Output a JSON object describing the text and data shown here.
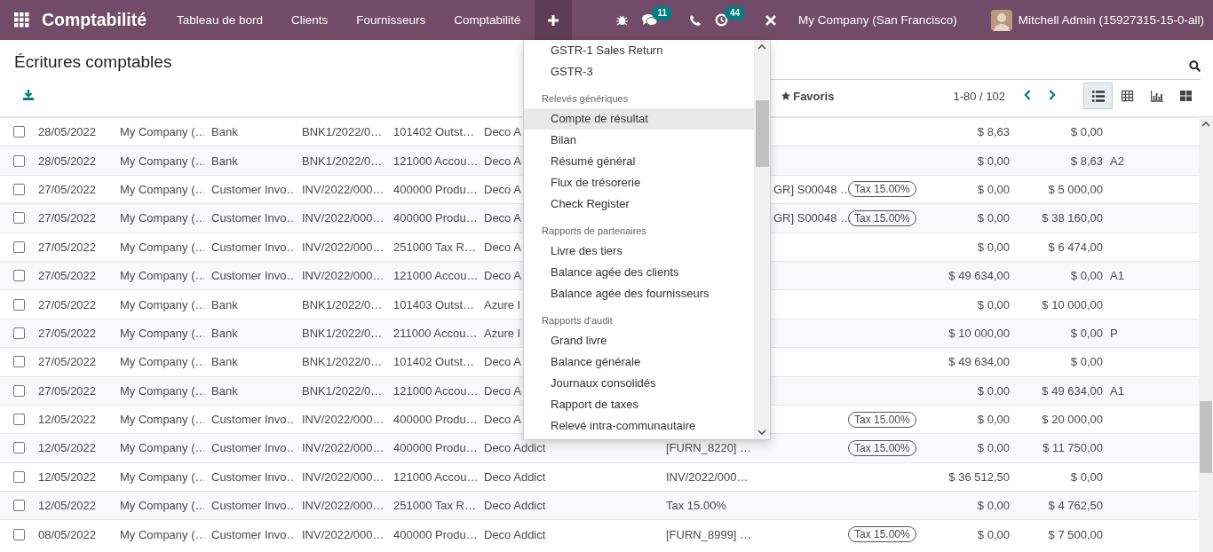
{
  "navbar": {
    "app_title": "Comptabilité",
    "menus": [
      "Tableau de bord",
      "Clients",
      "Fournisseurs",
      "Comptabilité"
    ],
    "quick_menu": {
      "expanded": true
    },
    "messages_badge": "11",
    "activities_badge": "44",
    "company": "My Company (San Francisco)",
    "user": "Mitchell Admin (15927315-15-0-all)"
  },
  "control_panel": {
    "title": "Écritures comptables",
    "favorites": "Favoris",
    "pager": "1-80 / 102",
    "views": [
      {
        "kind": "list",
        "selected": true
      },
      {
        "kind": "pivot",
        "selected": false
      },
      {
        "kind": "graph",
        "selected": false
      },
      {
        "kind": "kanban",
        "selected": false
      }
    ]
  },
  "report_menu": {
    "items": [
      {
        "kind": "item",
        "label": "GSTR-1 Sales Return",
        "selected": false
      },
      {
        "kind": "item",
        "label": "GSTR-3",
        "selected": false
      },
      {
        "kind": "header",
        "label": "Relevés génériques"
      },
      {
        "kind": "item",
        "label": "Compte de résultat",
        "selected": true
      },
      {
        "kind": "item",
        "label": "Bilan",
        "selected": false
      },
      {
        "kind": "item",
        "label": "Résumé général",
        "selected": false
      },
      {
        "kind": "item",
        "label": "Flux de trésorerie",
        "selected": false
      },
      {
        "kind": "item",
        "label": "Check Register",
        "selected": false
      },
      {
        "kind": "header",
        "label": "Rapports de partenaires"
      },
      {
        "kind": "item",
        "label": "Livre des tiers",
        "selected": false
      },
      {
        "kind": "item",
        "label": "Balance agée des clients",
        "selected": false
      },
      {
        "kind": "item",
        "label": "Balance agée des fournisseurs",
        "selected": false
      },
      {
        "kind": "header",
        "label": "Rapports d'audit"
      },
      {
        "kind": "item",
        "label": "Grand livre",
        "selected": false
      },
      {
        "kind": "item",
        "label": "Balance générale",
        "selected": false
      },
      {
        "kind": "item",
        "label": "Journaux consolidés",
        "selected": false
      },
      {
        "kind": "item",
        "label": "Rapport de taxes",
        "selected": false
      },
      {
        "kind": "item",
        "label": "Relevé intra-communautaire",
        "selected": false
      }
    ]
  },
  "table": {
    "rows": [
      {
        "checked": false,
        "date": "28/05/2022",
        "company": "My Company (…",
        "journal": "Bank",
        "entry": "BNK1/2022/0…",
        "account": "101402 Outst…",
        "partner": "Deco A",
        "label": "",
        "tax": "",
        "debit": "$ 8,63",
        "credit": "$ 0,00",
        "matching": ""
      },
      {
        "checked": false,
        "date": "28/05/2022",
        "company": "My Company (…",
        "journal": "Bank",
        "entry": "BNK1/2022/0…",
        "account": "121000 Accou…",
        "partner": "Deco A",
        "label": "",
        "tax": "",
        "debit": "$ 0,00",
        "credit": "$ 8,63",
        "matching": "A2"
      },
      {
        "checked": false,
        "date": "27/05/2022",
        "company": "My Company (…",
        "journal": "Customer Invo…",
        "entry": "INV/2022/000…",
        "account": "400000 Produ…",
        "partner": "Deco A",
        "label": "GR] S00048 …",
        "tax": "Tax 15.00%",
        "debit": "$ 0,00",
        "credit": "$ 5 000,00",
        "matching": ""
      },
      {
        "checked": false,
        "date": "27/05/2022",
        "company": "My Company (…",
        "journal": "Customer Invo…",
        "entry": "INV/2022/000…",
        "account": "400000 Produ…",
        "partner": "Deco A",
        "label": "GR] S00048 …",
        "tax": "Tax 15.00%",
        "debit": "$ 0,00",
        "credit": "$ 38 160,00",
        "matching": ""
      },
      {
        "checked": false,
        "date": "27/05/2022",
        "company": "My Company (…",
        "journal": "Customer Invo…",
        "entry": "INV/2022/000…",
        "account": "251000 Tax R…",
        "partner": "Deco A",
        "label": "",
        "tax": "",
        "debit": "$ 0,00",
        "credit": "$ 6 474,00",
        "matching": ""
      },
      {
        "checked": false,
        "date": "27/05/2022",
        "company": "My Company (…",
        "journal": "Customer Invo…",
        "entry": "INV/2022/000…",
        "account": "121000 Accou…",
        "partner": "Deco A",
        "label": "",
        "tax": "",
        "debit": "$ 49 634,00",
        "credit": "$ 0,00",
        "matching": "A1"
      },
      {
        "checked": false,
        "date": "27/05/2022",
        "company": "My Company (…",
        "journal": "Bank",
        "entry": "BNK1/2022/0…",
        "account": "101403 Outst…",
        "partner": "Azure I",
        "label": "",
        "tax": "",
        "debit": "$ 0,00",
        "credit": "$ 10 000,00",
        "matching": ""
      },
      {
        "checked": false,
        "date": "27/05/2022",
        "company": "My Company (…",
        "journal": "Bank",
        "entry": "BNK1/2022/0…",
        "account": "211000 Accou…",
        "partner": "Azure I",
        "label": "",
        "tax": "",
        "debit": "$ 10 000,00",
        "credit": "$ 0,00",
        "matching": "P"
      },
      {
        "checked": false,
        "date": "27/05/2022",
        "company": "My Company (…",
        "journal": "Bank",
        "entry": "BNK1/2022/0…",
        "account": "101402 Outst…",
        "partner": "Deco A",
        "label": "",
        "tax": "",
        "debit": "$ 49 634,00",
        "credit": "$ 0,00",
        "matching": ""
      },
      {
        "checked": false,
        "date": "27/05/2022",
        "company": "My Company (…",
        "journal": "Bank",
        "entry": "BNK1/2022/0…",
        "account": "121000 Accou…",
        "partner": "Deco A",
        "label": "",
        "tax": "",
        "debit": "$ 0,00",
        "credit": "$ 49 634,00",
        "matching": "A1"
      },
      {
        "checked": false,
        "date": "12/05/2022",
        "company": "My Company (…",
        "journal": "Customer Invo…",
        "entry": "INV/2022/000…",
        "account": "400000 Produ…",
        "partner": "Deco A",
        "label": "",
        "tax": "Tax 15.00%",
        "debit": "$ 0,00",
        "credit": "$ 20 000,00",
        "matching": ""
      },
      {
        "checked": false,
        "date": "12/05/2022",
        "company": "My Company (…",
        "journal": "Customer Invo…",
        "entry": "INV/2022/000…",
        "account": "400000 Produ…",
        "partner": "Deco Addict",
        "label": "[FURN_8220] …",
        "tax": "Tax 15.00%",
        "debit": "$ 0,00",
        "credit": "$ 11 750,00",
        "matching": ""
      },
      {
        "checked": false,
        "date": "12/05/2022",
        "company": "My Company (…",
        "journal": "Customer Invo…",
        "entry": "INV/2022/000…",
        "account": "121000 Accou…",
        "partner": "Deco Addict",
        "label": "INV/2022/000…",
        "tax": "",
        "debit": "$ 36 512,50",
        "credit": "$ 0,00",
        "matching": ""
      },
      {
        "checked": false,
        "date": "12/05/2022",
        "company": "My Company (…",
        "journal": "Customer Invo…",
        "entry": "INV/2022/000…",
        "account": "251000 Tax R…",
        "partner": "Deco Addict",
        "label": "Tax 15.00%",
        "tax": "",
        "debit": "$ 0,00",
        "credit": "$ 4 762,50",
        "matching": ""
      },
      {
        "checked": false,
        "date": "08/05/2022",
        "company": "My Company (…",
        "journal": "Customer Invo…",
        "entry": "INV/2022/000…",
        "account": "400000 Produ…",
        "partner": "Deco Addict",
        "label": "[FURN_8999] …",
        "tax": "Tax 15.00%",
        "debit": "$ 0,00",
        "credit": "$ 7 500,00",
        "matching": ""
      }
    ]
  }
}
